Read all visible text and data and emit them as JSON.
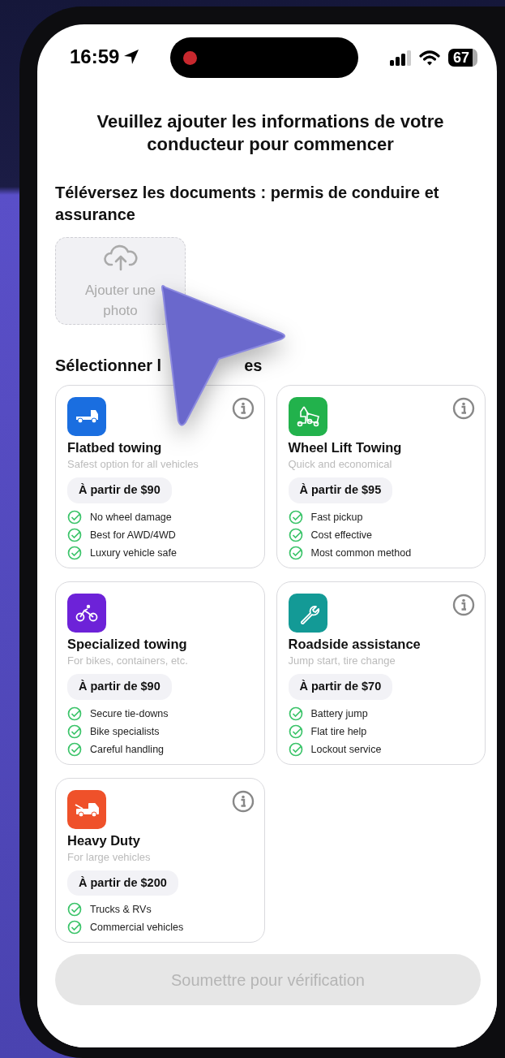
{
  "status_bar": {
    "time": "16:59",
    "battery": "67",
    "recording": true
  },
  "heading": "Veuillez ajouter les informations de votre conducteur pour commencer",
  "documents_label": "Téléversez les documents : permis de conduire et assurance",
  "upload": {
    "label": "Ajouter une photo"
  },
  "section_title_parts": [
    "Sélectionner l",
    "es"
  ],
  "services": [
    {
      "kind": "flatbed",
      "color": "#1a6ee0",
      "title": "Flatbed towing",
      "subtitle": "Safest option for all vehicles",
      "price": "À partir de $90",
      "info": true,
      "features": [
        "No wheel damage",
        "Best for AWD/4WD",
        "Luxury vehicle safe"
      ]
    },
    {
      "kind": "tow",
      "color": "#22b24c",
      "title": "Wheel Lift Towing",
      "subtitle": "Quick and economical",
      "price": "À partir de $95",
      "info": true,
      "features": [
        "Fast pickup",
        "Cost effective",
        "Most common method"
      ]
    },
    {
      "kind": "bike",
      "color": "#6d22d8",
      "title": "Specialized towing",
      "subtitle": "For bikes, containers, etc.",
      "price": "À partir de $90",
      "info": false,
      "features": [
        "Secure tie-downs",
        "Bike specialists",
        "Careful handling"
      ]
    },
    {
      "kind": "wrench",
      "color": "#139a96",
      "title": "Roadside assistance",
      "subtitle": "Jump start, tire change",
      "price": "À partir de $70",
      "info": true,
      "features": [
        "Battery jump",
        "Flat tire help",
        "Lockout service"
      ]
    },
    {
      "kind": "heavy",
      "color": "#ef512a",
      "title": "Heavy Duty",
      "subtitle": "For large vehicles",
      "price": "À partir de $200",
      "info": true,
      "features": [
        "Trucks & RVs",
        "Commercial vehicles"
      ]
    }
  ],
  "submit": {
    "label": "Soumettre pour vérification",
    "disabled": true
  }
}
